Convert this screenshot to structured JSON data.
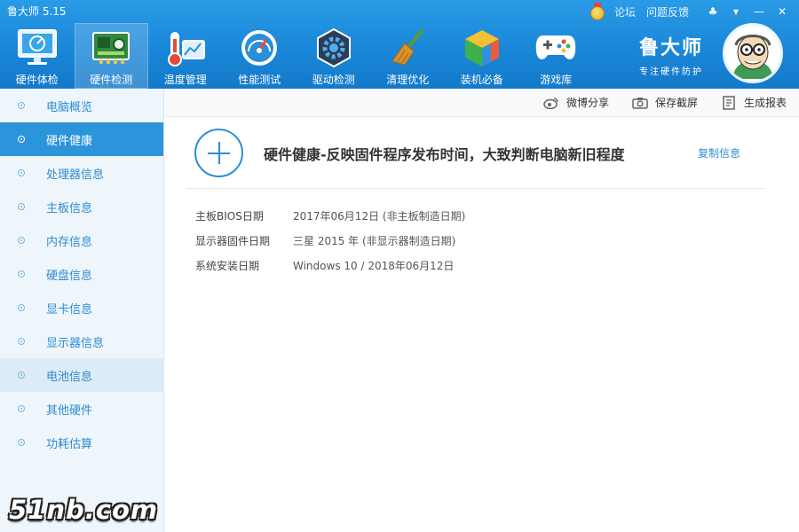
{
  "app": {
    "title": "鲁大师 5.15"
  },
  "top_links": {
    "forum": "论坛",
    "feedback": "问题反馈",
    "skin": "♣",
    "menu": "▾",
    "minimize": "—",
    "close": "✕"
  },
  "toolbar": [
    {
      "label": "硬件体检",
      "icon": "monitor-check-icon"
    },
    {
      "label": "硬件检测",
      "icon": "circuit-board-icon"
    },
    {
      "label": "温度管理",
      "icon": "thermometer-icon"
    },
    {
      "label": "性能测试",
      "icon": "speedometer-icon"
    },
    {
      "label": "驱动检测",
      "icon": "driver-gear-icon"
    },
    {
      "label": "清理优化",
      "icon": "broom-icon"
    },
    {
      "label": "装机必备",
      "icon": "cube-icon"
    },
    {
      "label": "游戏库",
      "icon": "gamepad-icon"
    }
  ],
  "brand": {
    "name": "鲁大师",
    "slogan": "专注硬件防护"
  },
  "sidebar": [
    {
      "label": "电脑概览"
    },
    {
      "label": "硬件健康"
    },
    {
      "label": "处理器信息"
    },
    {
      "label": "主板信息"
    },
    {
      "label": "内存信息"
    },
    {
      "label": "硬盘信息"
    },
    {
      "label": "显卡信息"
    },
    {
      "label": "显示器信息"
    },
    {
      "label": "电池信息"
    },
    {
      "label": "其他硬件"
    },
    {
      "label": "功耗估算"
    }
  ],
  "actions": {
    "share": "微博分享",
    "screenshot": "保存截屏",
    "report": "生成报表"
  },
  "main": {
    "headline": "硬件健康-反映固件程序发布时间，大致判断电脑新旧程度",
    "copy": "复制信息",
    "rows": [
      {
        "key": "主板BIOS日期",
        "value": "2017年06月12日 (非主板制造日期)"
      },
      {
        "key": "显示器固件日期",
        "value": "三星 2015 年 (非显示器制造日期)"
      },
      {
        "key": "系统安装日期",
        "value": "Windows 10 / 2018年06月12日"
      }
    ]
  },
  "watermark": "51nb.com",
  "colors": {
    "header": "#1a87d8",
    "accent": "#2b95db",
    "sidebar_bg": "#eef6fb"
  }
}
